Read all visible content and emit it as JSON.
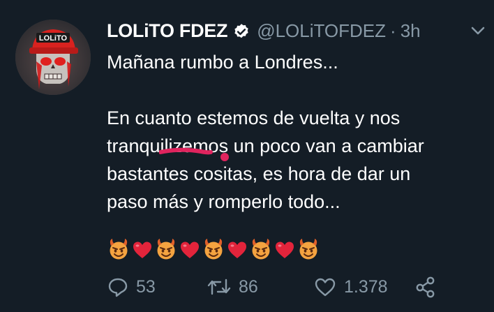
{
  "tweet": {
    "name": "LOLiTO FDEZ",
    "handle": "@LOLiTOFDEZ",
    "separator": "·",
    "time": "3h",
    "avatar_text": "LOLiTO",
    "lines": [
      "Mañana rumbo a Londres...",
      "",
      "En cuanto estemos de vuelta y nos",
      "tranquilizemos un poco van a cambiar",
      "bastantes cositas, es hora de dar un",
      "paso más y romperlo todo..."
    ],
    "emojis": [
      "smiling-face-with-horns",
      "red-heart",
      "smiling-face-with-horns",
      "red-heart",
      "smiling-face-with-horns",
      "red-heart",
      "smiling-face-with-horns",
      "red-heart",
      "smiling-face-with-horns"
    ],
    "replies": "53",
    "retweets": "86",
    "likes": "1.378"
  },
  "icons": {
    "verified": "verified-badge-icon",
    "chevron": "chevron-down-icon",
    "reply": "reply-icon",
    "retweet": "retweet-icon",
    "like": "heart-icon",
    "share": "share-icon"
  },
  "colors": {
    "background": "#141d26",
    "text": "#ffffff",
    "secondary": "#8899a6",
    "scribble": "#e0245e"
  }
}
